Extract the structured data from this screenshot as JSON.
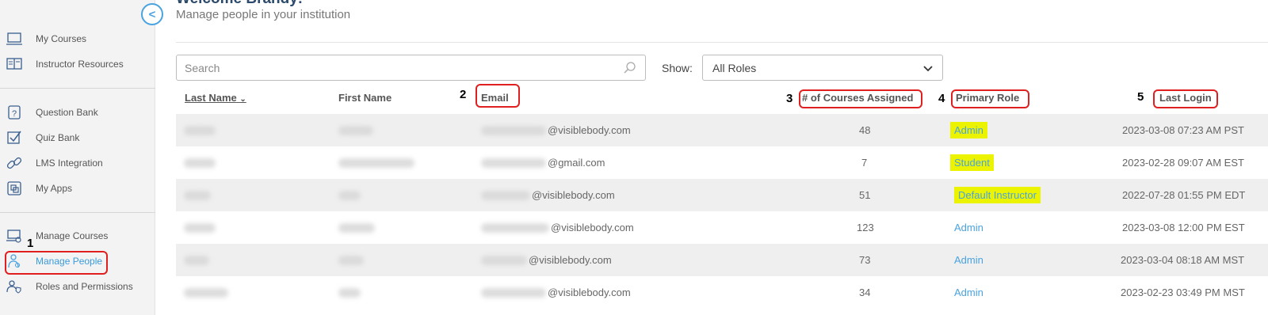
{
  "sidebar": {
    "group1": [
      {
        "label": "My Courses",
        "icon": "laptop-icon"
      },
      {
        "label": "Instructor Resources",
        "icon": "book-icon"
      }
    ],
    "group2": [
      {
        "label": "Question Bank",
        "icon": "question-icon"
      },
      {
        "label": "Quiz Bank",
        "icon": "checkbox-icon"
      },
      {
        "label": "LMS Integration",
        "icon": "link-icon"
      },
      {
        "label": "My Apps",
        "icon": "apps-icon"
      }
    ],
    "group3": [
      {
        "label": "Manage Courses",
        "icon": "course-gear-icon"
      },
      {
        "label": "Manage People",
        "icon": "people-icon"
      },
      {
        "label": "Roles and Permissions",
        "icon": "shield-icon"
      }
    ]
  },
  "header": {
    "title": "Welcome Brandy!",
    "subtitle": "Manage people in your institution"
  },
  "toolbar": {
    "search_placeholder": "Search",
    "show_label": "Show:",
    "role_filter": "All Roles"
  },
  "annotations": {
    "n1": "1",
    "n2": "2",
    "n3": "3",
    "n4": "4",
    "n5": "5"
  },
  "table": {
    "headers": {
      "last_name": "Last Name",
      "first_name": "First Name",
      "email": "Email",
      "courses": "# of Courses Assigned",
      "role": "Primary Role",
      "last_login": "Last Login"
    },
    "rows": [
      {
        "email_domain": "@visiblebody.com",
        "courses": "48",
        "role": "Admin",
        "login": "2023-03-08 07:23 AM PST"
      },
      {
        "email_domain": "@gmail.com",
        "courses": "7",
        "role": "Student",
        "login": "2023-02-28 09:07 AM EST"
      },
      {
        "email_domain": "@visiblebody.com",
        "courses": "51",
        "role": "Default Instructor",
        "login": "2022-07-28 01:55 PM EDT"
      },
      {
        "email_domain": "@visiblebody.com",
        "courses": "123",
        "role": "Admin",
        "login": "2023-03-08 12:00 PM EST"
      },
      {
        "email_domain": "@visiblebody.com",
        "courses": "73",
        "role": "Admin",
        "login": "2023-03-04 08:18 AM MST"
      },
      {
        "email_domain": "@visiblebody.com",
        "courses": "34",
        "role": "Admin",
        "login": "2023-02-23 03:49 PM MST"
      }
    ]
  },
  "colors": {
    "accent": "#4aa3df",
    "highlight": "#ecf300",
    "annotation_box": "#e02020"
  }
}
